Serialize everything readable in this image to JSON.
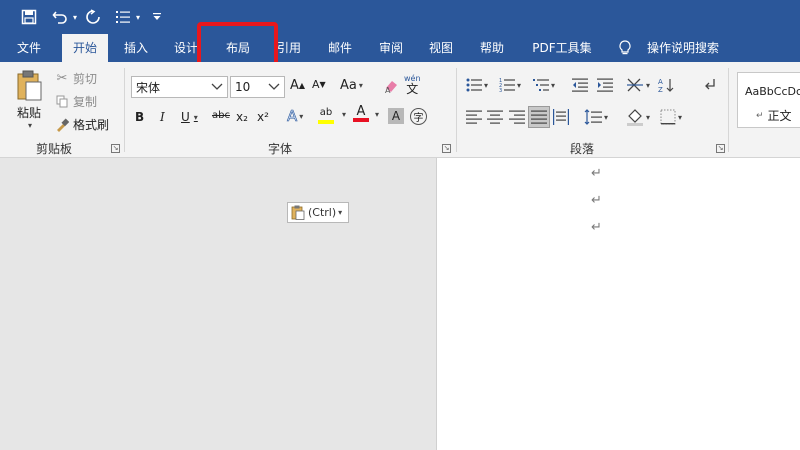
{
  "quick_access": {
    "save_icon": "save-icon",
    "undo_icon": "undo-icon",
    "redo_icon": "redo-icon",
    "list_icon": "list-icon",
    "customize_icon": "customize-icon"
  },
  "tabs": [
    {
      "label": "文件"
    },
    {
      "label": "开始"
    },
    {
      "label": "插入"
    },
    {
      "label": "设计"
    },
    {
      "label": "布局"
    },
    {
      "label": "引用"
    },
    {
      "label": "邮件"
    },
    {
      "label": "审阅"
    },
    {
      "label": "视图"
    },
    {
      "label": "帮助"
    },
    {
      "label": "PDF工具集"
    },
    {
      "label": "操作说明搜索"
    }
  ],
  "clipboard": {
    "paste": "粘贴",
    "cut": "剪切",
    "copy": "复制",
    "format_painter": "格式刷",
    "group_label": "剪贴板"
  },
  "font": {
    "font_name": "宋体",
    "font_size": "10",
    "grow": "A",
    "shrink": "A",
    "case": "Aa",
    "bold": "B",
    "italic": "I",
    "underline": "U",
    "strike": "abc",
    "subscript": "x₂",
    "superscript": "x²",
    "group_label": "字体",
    "phonetic_top": "wén",
    "phonetic_char": "文",
    "enclose_char": "字",
    "char_shading": "A",
    "font_color": "A",
    "text_effect": "A",
    "highlight": "ab"
  },
  "paragraph": {
    "group_label": "段落"
  },
  "styles": {
    "sample": "AaBbCcDc",
    "normal": "正文"
  },
  "document": {
    "paragraph_mark": "↵",
    "paste_options": "(Ctrl)"
  },
  "colors": {
    "ribbon_blue": "#2b579a",
    "highlight_red": "#e8171d",
    "font_color_red": "#e81123",
    "highlight_yellow": "#ffff00"
  }
}
